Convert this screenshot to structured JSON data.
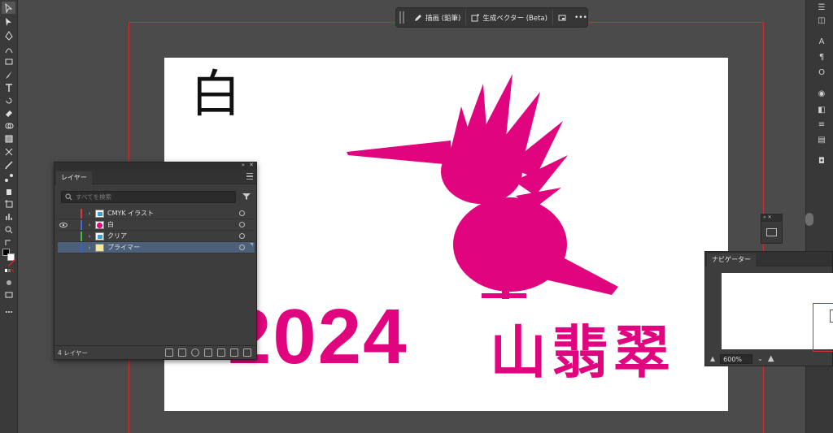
{
  "context_bar": {
    "draw_label": "描画 (鉛筆)",
    "generative_label": "生成ベクター (Beta)",
    "more_label": "•••"
  },
  "artboard": {
    "shiro_text": "白",
    "year_text": "2024",
    "kanji_text": "山翡翠",
    "accent_color": "#e0047e"
  },
  "layers_panel": {
    "tab_label": "レイヤー",
    "search_placeholder": "すべてを検索",
    "layers": [
      {
        "name": "CMYK イラスト",
        "color": "#e0383a",
        "visible": false,
        "selected": false
      },
      {
        "name": "白",
        "color": "#4b6bdc",
        "visible": true,
        "selected": false
      },
      {
        "name": "クリア",
        "color": "#39c446",
        "visible": false,
        "selected": false
      },
      {
        "name": "プライマー",
        "color": "#3d5bd6",
        "visible": false,
        "selected": true
      }
    ],
    "layer_count": "4 レイヤー"
  },
  "navigator_panel": {
    "tab_label": "ナビゲーター",
    "zoom": "600%"
  }
}
